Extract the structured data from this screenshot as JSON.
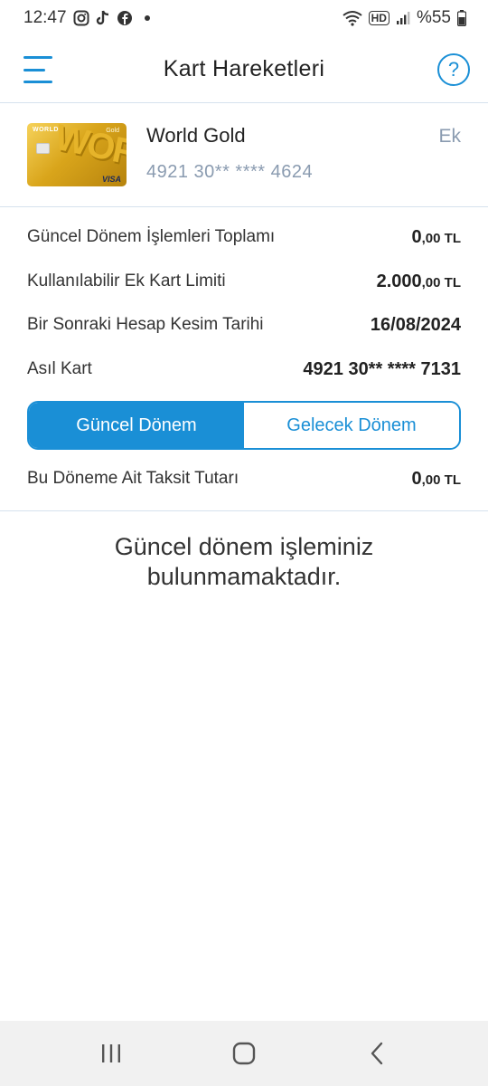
{
  "status_bar": {
    "time": "12:47",
    "battery": "%55",
    "icons": [
      "instagram-icon",
      "tiktok-icon",
      "facebook-icon",
      "dot-icon",
      "wifi-icon",
      "hd-icon",
      "signal-icon",
      "battery-icon"
    ]
  },
  "header": {
    "title": "Kart Hareketleri",
    "help": "?",
    "accent_color": "#1a8fd6"
  },
  "card": {
    "name": "World Gold",
    "number": "4921 30** **** 4624",
    "type": "Ek",
    "image_brand": "WORLD",
    "image_tier": "Gold",
    "image_word": "WORLD",
    "image_network": "VISA"
  },
  "info": {
    "total": {
      "label": "Güncel Dönem İşlemleri Toplamı",
      "value_main": "0",
      "value_decimal": ",00 TL"
    },
    "limit": {
      "label": "Kullanılabilir Ek Kart Limiti",
      "value_main": "2.000",
      "value_decimal": ",00 TL"
    },
    "cut_date": {
      "label": "Bir Sonraki Hesap Kesim Tarihi",
      "value": "16/08/2024"
    },
    "main_card": {
      "label": "Asıl Kart",
      "value": "4921 30** **** 7131"
    }
  },
  "tabs": {
    "current": "Güncel Dönem",
    "next": "Gelecek Dönem",
    "selected": "current"
  },
  "installment": {
    "label": "Bu Döneme Ait Taksit Tutarı",
    "value_main": "0",
    "value_decimal": ",00 TL"
  },
  "empty_message": "Güncel dönem işleminiz bulunmamaktadır.",
  "nav": {
    "icons": [
      "recent-apps-icon",
      "home-icon",
      "back-icon"
    ]
  }
}
